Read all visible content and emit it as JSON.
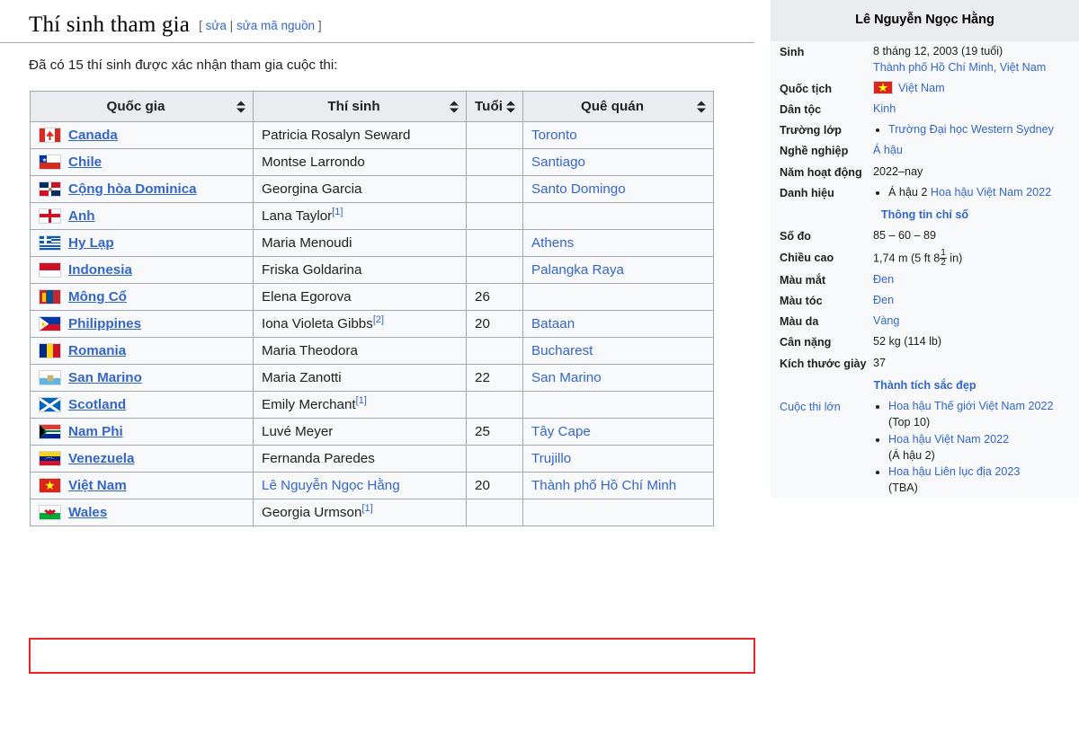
{
  "section": {
    "heading": "Thí sinh tham gia",
    "edit_open": "[",
    "edit_link1": "sửa",
    "edit_sep": "|",
    "edit_link2": "sửa mã nguồn",
    "edit_close": "]",
    "lead": "Đã có 15 thí sinh được xác nhận tham gia cuộc thi:"
  },
  "table": {
    "headers": [
      "Quốc gia",
      "Thí sinh",
      "Tuổi",
      "Quê quán"
    ],
    "rows": [
      {
        "flag": "ca",
        "country": "Canada",
        "name": "Patricia Rosalyn Seward",
        "ref": "",
        "age": "",
        "home": "Toronto",
        "highlight": false
      },
      {
        "flag": "cl",
        "country": "Chile",
        "name": "Montse Larrondo",
        "ref": "",
        "age": "",
        "home": "Santiago",
        "highlight": false
      },
      {
        "flag": "do",
        "country": "Cộng hòa Dominica",
        "name": "Georgina Garcia",
        "ref": "",
        "age": "",
        "home": "Santo Domingo",
        "highlight": false
      },
      {
        "flag": "en",
        "country": "Anh",
        "name": "Lana Taylor",
        "ref": "[1]",
        "age": "",
        "home": "",
        "highlight": false
      },
      {
        "flag": "gr",
        "country": "Hy Lạp",
        "name": "Maria Menoudi",
        "ref": "",
        "age": "",
        "home": "Athens",
        "highlight": false
      },
      {
        "flag": "id",
        "country": "Indonesia",
        "name": "Friska Goldarina",
        "ref": "",
        "age": "",
        "home": "Palangka Raya",
        "highlight": false
      },
      {
        "flag": "mn",
        "country": "Mông Cổ",
        "name": "Elena Egorova",
        "ref": "",
        "age": "26",
        "home": "",
        "highlight": false
      },
      {
        "flag": "ph",
        "country": "Philippines",
        "name": "Iona Violeta Gibbs",
        "ref": "[2]",
        "age": "20",
        "home": "Bataan",
        "highlight": false
      },
      {
        "flag": "ro",
        "country": "Romania",
        "name": "Maria Theodora",
        "ref": "",
        "age": "",
        "home": "Bucharest",
        "highlight": false
      },
      {
        "flag": "sm",
        "country": "San Marino",
        "name": "Maria Zanotti",
        "ref": "",
        "age": "22",
        "home": "San Marino",
        "highlight": false
      },
      {
        "flag": "sc",
        "country": "Scotland",
        "name": "Emily Merchant",
        "ref": "[1]",
        "age": "",
        "home": "",
        "highlight": false
      },
      {
        "flag": "za",
        "country": "Nam Phi",
        "name": "Luvé Meyer",
        "ref": "",
        "age": "25",
        "home": "Tây Cape",
        "highlight": false
      },
      {
        "flag": "ve",
        "country": "Venezuela",
        "name": "Fernanda Paredes",
        "ref": "",
        "age": "",
        "home": "Trujillo",
        "highlight": false
      },
      {
        "flag": "vn",
        "country": "Việt Nam",
        "name": "Lê Nguyễn Ngọc Hằng",
        "ref": "",
        "age": "20",
        "home": "Thành phố Hồ Chí Minh",
        "highlight": true
      },
      {
        "flag": "wl",
        "country": "Wales",
        "name": "Georgia Urmson",
        "ref": "[1]",
        "age": "",
        "home": "",
        "highlight": false
      }
    ]
  },
  "infobox": {
    "title": "Lê Nguyễn Ngọc Hằng",
    "birth_label": "Sinh",
    "birth_date": "8 tháng 12, 2003 (19 tuổi)",
    "birth_place": "Thành phố Hồ Chí Minh, Việt Nam",
    "nationality_label": "Quốc tịch",
    "nationality_value": "Việt Nam",
    "ethnicity_label": "Dân tộc",
    "ethnicity_value": "Kinh",
    "education_label": "Trường lớp",
    "education_items": [
      "Trường Đại học Western Sydney"
    ],
    "occupation_label": "Nghề nghiệp",
    "occupation_value": "Á hậu",
    "years_label": "Năm hoạt động",
    "years_value": "2022–nay",
    "titles_label": "Danh hiệu",
    "titles_items": [
      {
        "prefix": "Á hậu 2 ",
        "link": "Hoa hậu Việt Nam 2022"
      }
    ],
    "stats_section": "Thông tin chỉ số",
    "measurements_label": "Số đo",
    "measurements_value": "85 – 60 – 89",
    "height_label": "Chiều cao",
    "height_metric": "1,74 m (5 ft 8",
    "height_frac_num": "1",
    "height_frac_den": "2",
    "height_suffix": " in)",
    "eye_label": "Màu mắt",
    "eye_value": "Đen",
    "hair_label": "Màu tóc",
    "hair_value": "Đen",
    "skin_label": "Màu da",
    "skin_value": "Vàng",
    "weight_label": "Cân nặng",
    "weight_value_kg": "52 kg",
    "weight_value_lb": " (114 lb)",
    "shoe_label": "Kích thước giày",
    "shoe_value": "37",
    "pageants_section": "Thành tích sắc đẹp",
    "pageants_label": "Cuộc thi lớn",
    "pageants_items": [
      {
        "link": "Hoa hậu Thế giới Việt Nam 2022",
        "note": "(Top 10)",
        "highlight": false
      },
      {
        "link": "Hoa hậu Việt Nam 2022",
        "note": "(Á hậu 2)",
        "highlight": false
      },
      {
        "link": "Hoa hậu Liên lục địa 2023",
        "note": "(TBA)",
        "highlight": true
      }
    ]
  },
  "colors": {
    "link": "#3366cc",
    "highlight_border": "#ee2222",
    "table_border": "#a2a9b1",
    "table_header_bg": "#eaecf0",
    "table_bg": "#f8f9fa"
  }
}
